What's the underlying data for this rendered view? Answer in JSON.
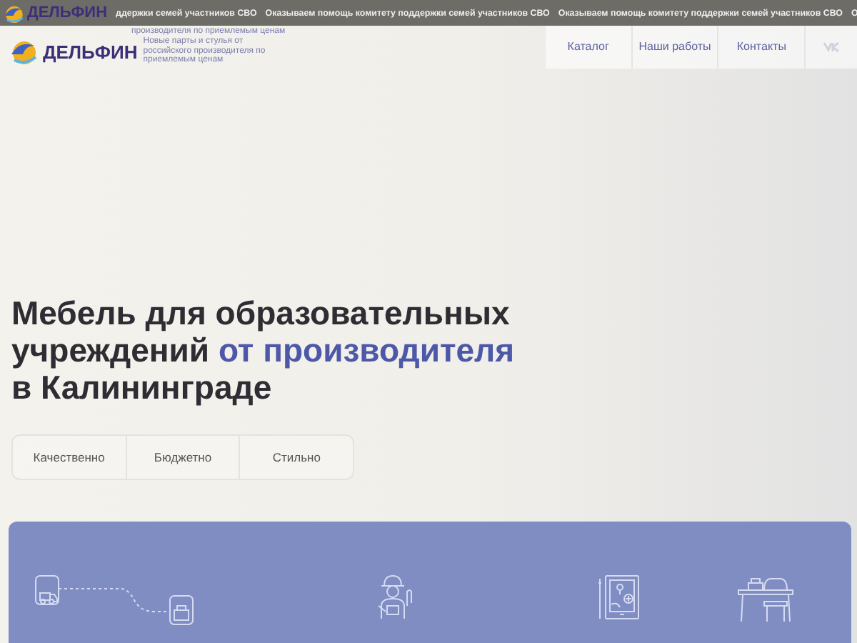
{
  "ticker": {
    "items": [
      "ддержки семей участников СВО",
      "Оказываем помощь комитету поддержки семей участников СВО",
      "Оказываем помощь комитету поддержки семей участников СВО",
      "О"
    ]
  },
  "ghost_header": {
    "logo": "ДЕЛЬФИН",
    "tagline": "производителя по приемлемым ценам"
  },
  "header": {
    "logo": "ДЕЛЬФИН",
    "tagline": "Новые парты и стулья от российского производителя по приемлемым ценам",
    "nav": [
      "Каталог",
      "Наши работы",
      "Контакты"
    ]
  },
  "hero": {
    "title": [
      {
        "text": "Мебель для образовательных учреждений ",
        "accent": false
      },
      {
        "text": "от производителя",
        "accent": true
      },
      {
        "text": " в Калининграде",
        "accent": false
      }
    ],
    "features": [
      "Качественно",
      "Бюджетно",
      "Стильно"
    ]
  },
  "services": [
    {
      "kind": "delivery"
    },
    {
      "kind": "worker"
    },
    {
      "kind": "tablet"
    },
    {
      "kind": "desk"
    }
  ]
}
